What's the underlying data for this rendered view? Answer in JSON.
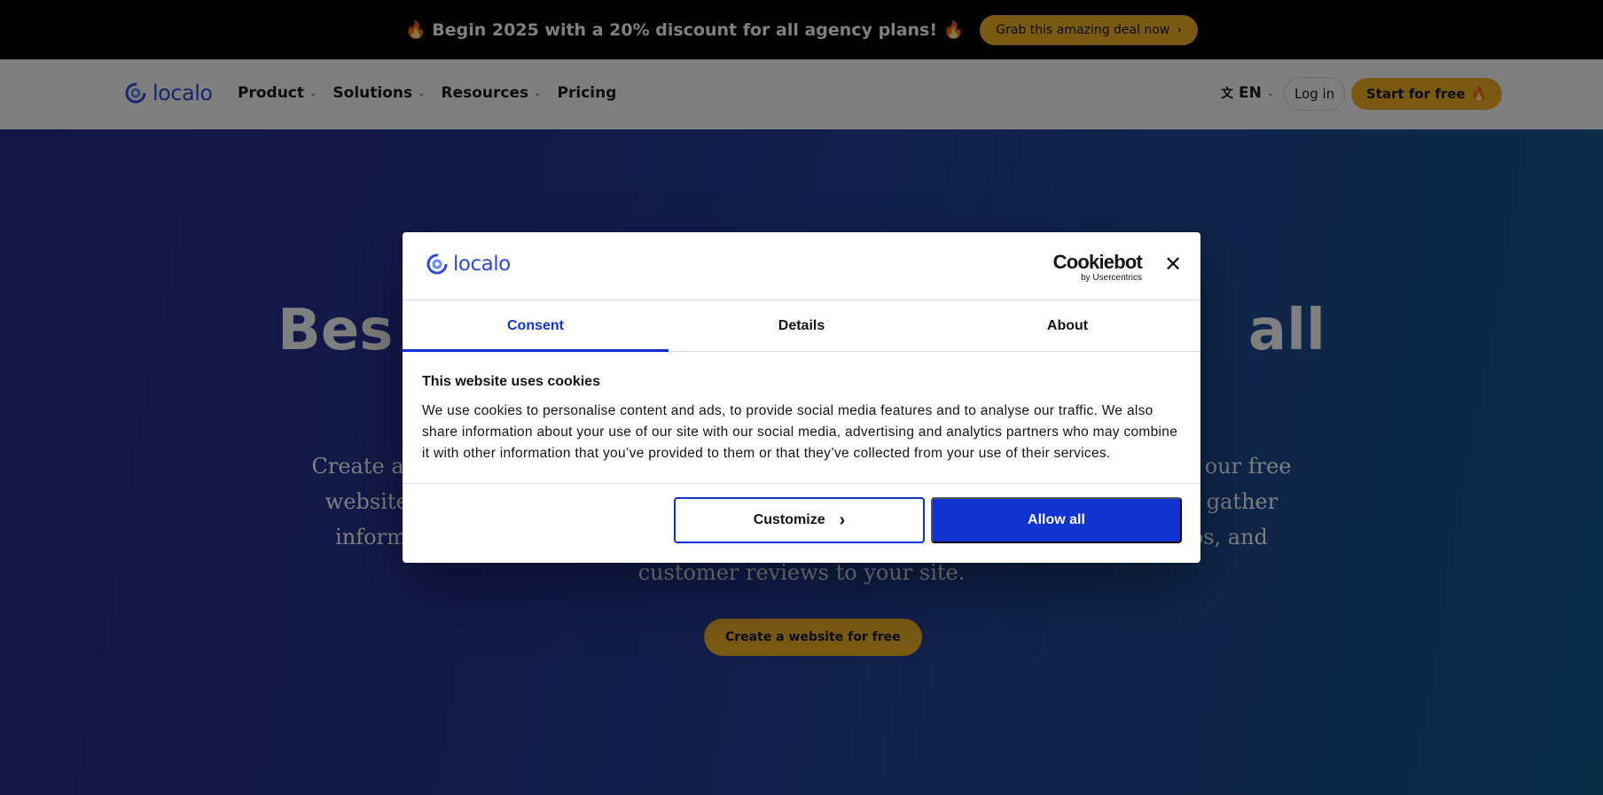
{
  "promo": {
    "text": "🔥 Begin 2025 with a 20% discount for all agency plans! 🔥",
    "button_label": "Grab this amazing deal now",
    "button_icon": "chevron-right-icon"
  },
  "nav": {
    "logo_text": "localo",
    "links": [
      {
        "label": "Product",
        "has_dropdown": true
      },
      {
        "label": "Solutions",
        "has_dropdown": true
      },
      {
        "label": "Resources",
        "has_dropdown": true
      },
      {
        "label": "Pricing",
        "has_dropdown": false
      }
    ],
    "language": "EN",
    "login_label": "Log in",
    "start_label": "Start for free",
    "start_emoji": "🔥"
  },
  "hero": {
    "title_left": "Bes",
    "title_right": "all",
    "subtitle_line1_left": "Create a",
    "subtitle_line1_right": "n our free",
    "subtitle_line2_left": "website",
    "subtitle_line2_right": "gather",
    "subtitle_line3_left": "informa",
    "subtitle_line3_right": "tos, and",
    "subtitle_line4": "customer reviews to your site.",
    "cta_label": "Create a website for free"
  },
  "cookie_dialog": {
    "logo_text": "localo",
    "cookiebot_main": "Cookiebot",
    "cookiebot_sub": "by Usercentrics",
    "tabs": [
      {
        "label": "Consent",
        "active": true
      },
      {
        "label": "Details",
        "active": false
      },
      {
        "label": "About",
        "active": false
      }
    ],
    "heading": "This website uses cookies",
    "body": "We use cookies to personalise content and ads, to provide social media features and to analyse our traffic. We also share information about your use of our site with our social media, advertising and analytics partners who may combine it with other information that you’ve provided to them or that they’ve collected from your use of their services.",
    "customize_label": "Customize",
    "allow_label": "Allow all"
  },
  "colors": {
    "accent_yellow": "#f5b427",
    "brand_blue": "#2f4bd6",
    "cookie_blue": "#1032cf"
  }
}
